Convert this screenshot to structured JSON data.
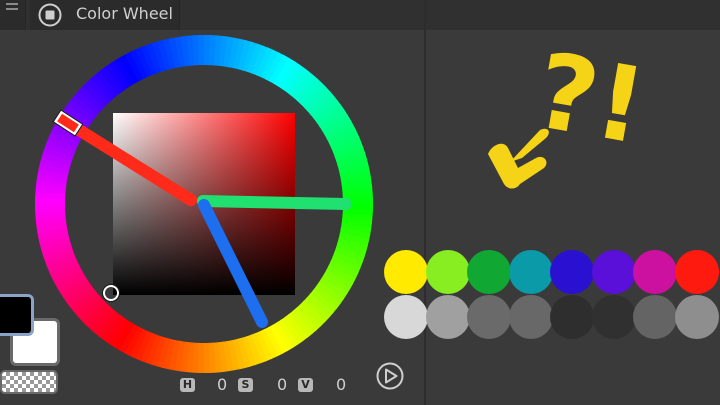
{
  "panel": {
    "title": "Color Wheel",
    "icon": "record-icon"
  },
  "color_wheel": {
    "hue_marker_color": "#ff2a1a",
    "square_base_color": "#ff0000"
  },
  "hsv": {
    "h_label": "H",
    "h_value": "0",
    "s_label": "S",
    "s_value": "0",
    "v_label": "V",
    "v_value": "0"
  },
  "colors": {
    "main": "#000000",
    "sub": "#ffffff"
  },
  "annotation": {
    "text": "?!",
    "color": "#f5d316",
    "arrow_color": "#f5d316",
    "lines": {
      "red": "#ff2a1a",
      "green": "#20e070",
      "blue": "#1e6ef0"
    }
  },
  "swatches": {
    "row1": [
      "#ffea00",
      "#88ee22",
      "#10a832",
      "#0a9aa8",
      "#2a10d0",
      "#5a10d8",
      "#cc10a0",
      "#ff1a10"
    ],
    "row2": [
      "#d8d8d8",
      "#a0a0a0",
      "#6a6a6a",
      "#686868",
      "#2e2e2e",
      "#303030",
      "#646464",
      "#8e8e8e"
    ]
  }
}
